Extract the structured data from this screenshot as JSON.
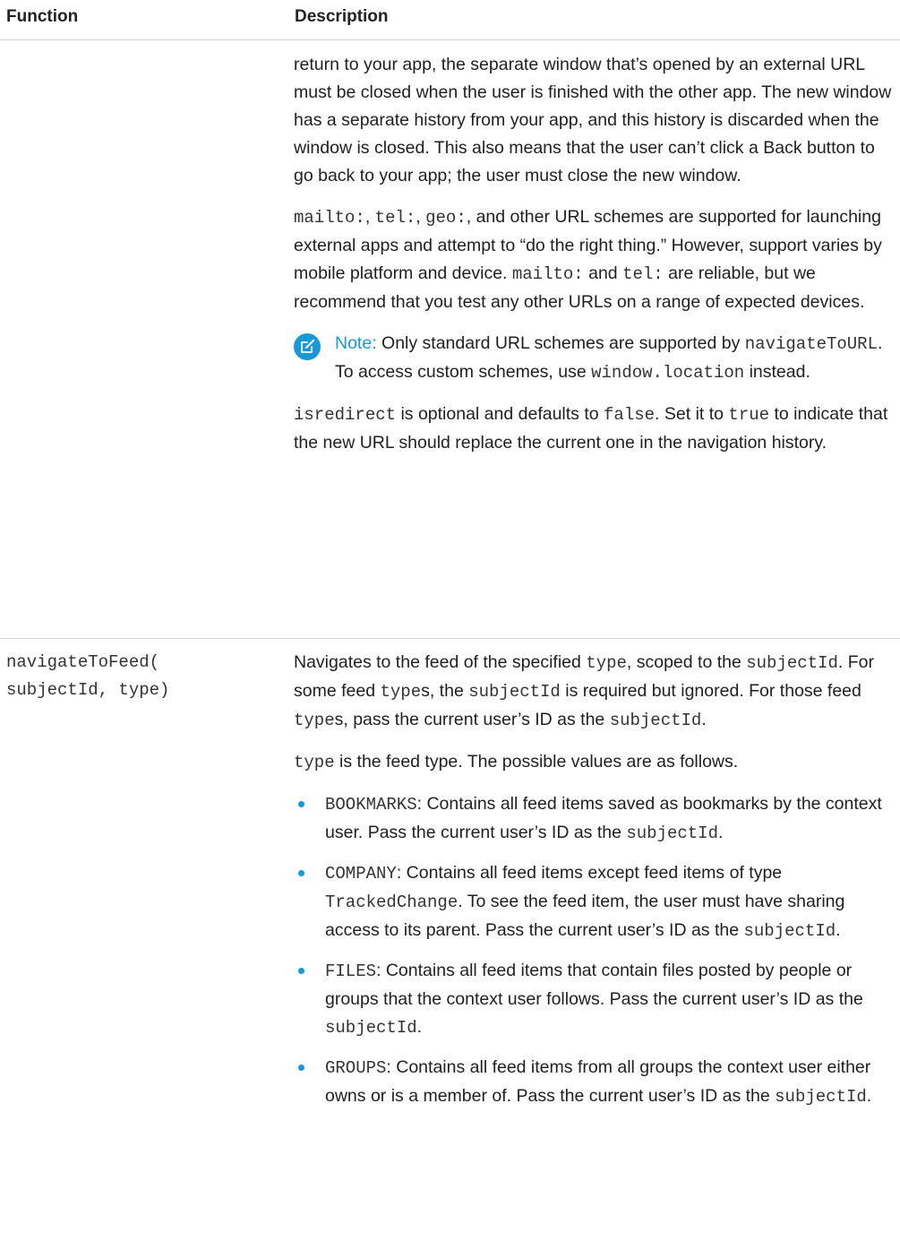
{
  "header": {
    "function_label": "Function",
    "description_label": "Description"
  },
  "row1": {
    "para1": "return to your app, the separate window that’s opened by an external URL must be closed when the user is finished with the other app. The new window has a separate history from your app, and this history is discarded when the window is closed. This also means that the user can’t click a Back button to go back to your app; the user must close the new window.",
    "para2": {
      "code_mailto": "mailto:",
      "sep1": ", ",
      "code_tel": "tel:",
      "sep2": ", ",
      "code_geo": "geo:",
      "text1": ", and other URL schemes are supported for launching external apps and attempt to “do the right thing.” However, support varies by mobile platform and device. ",
      "code_mailto2": "mailto:",
      "text2": " and ",
      "code_tel2": "tel:",
      "text3": " are reliable, but we recommend that you test any other URLs on a range of expected devices."
    },
    "note": {
      "label": "Note:",
      "text1": " Only standard URL schemes are supported by ",
      "code_nav": "navigateToURL",
      "text2": ". To access custom schemes, use ",
      "code_loc": "window.location",
      "text3": " instead."
    },
    "para3": {
      "code_isredirect": "isredirect",
      "text1": " is optional and defaults to ",
      "code_false": "false",
      "text2": ". Set it to ",
      "code_true": "true",
      "text3": " to indicate that the new URL should replace the current one in the navigation history."
    }
  },
  "row2": {
    "function_line1": "navigateToFeed(",
    "function_line2": "subjectId, type)",
    "para1": {
      "text1": "Navigates to the feed of the specified ",
      "code_type": "type",
      "text2": ", scoped to the ",
      "code_subj": "subjectId",
      "text3": ". For some feed ",
      "code_types": "type",
      "text4": "s, the ",
      "code_subj2": "subjectId",
      "text5": " is required but ignored. For those feed ",
      "code_types2": "type",
      "text6": "s, pass the current user’s ID as the ",
      "code_subj3": "subjectId",
      "text7": "."
    },
    "para2": {
      "code_type": "type",
      "text1": " is the feed type. The possible values are as follows."
    },
    "bullets": [
      {
        "code": "BOOKMARKS",
        "text1": ": Contains all feed items saved as bookmarks by the context user. Pass the current user’s ID as the ",
        "code2": "subjectId",
        "text2": "."
      },
      {
        "code": "COMPANY",
        "text1": ": Contains all feed items except feed items of type ",
        "code2": "TrackedChange",
        "text2": ". To see the feed item, the user must have sharing access to its parent. Pass the current user’s ID as the ",
        "code3": "subjectId",
        "text3": "."
      },
      {
        "code": "FILES",
        "text1": ": Contains all feed items that contain files posted by people or groups that the context user follows. Pass the current user’s ID as the ",
        "code2": "subjectId",
        "text2": "."
      },
      {
        "code": "GROUPS",
        "text1": ": Contains all feed items from all groups the context user either owns or is a member of. Pass the current user’s ID as the ",
        "code2": "subjectId",
        "text2": "."
      }
    ]
  }
}
